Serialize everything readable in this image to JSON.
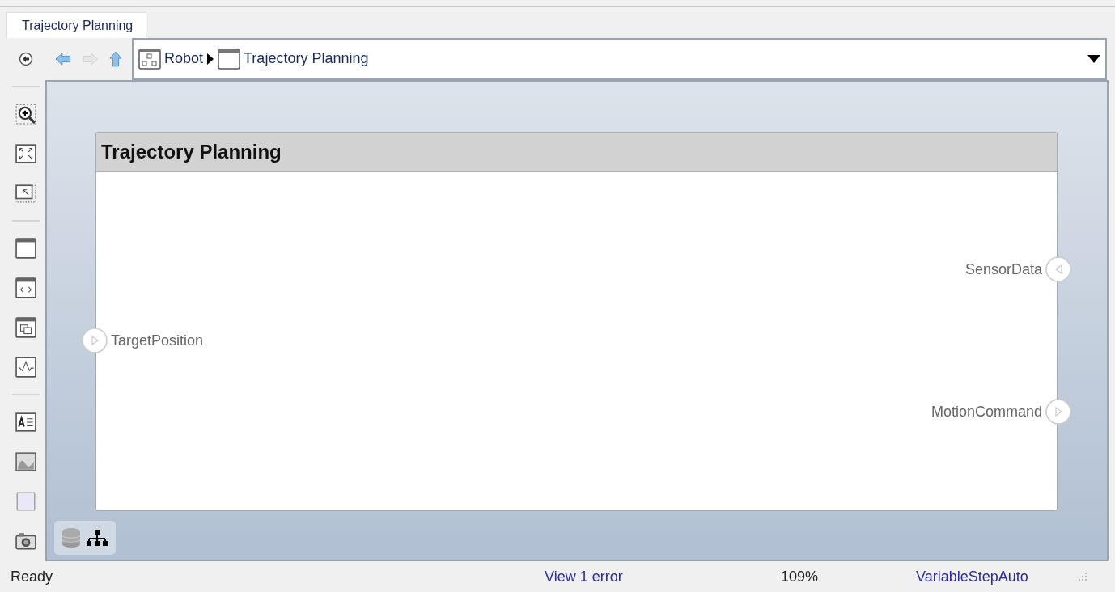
{
  "tabs": [
    {
      "label": "Trajectory Planning",
      "selected": true
    }
  ],
  "navigation": [
    {
      "kind": "back",
      "disabled": false
    },
    {
      "kind": "forward",
      "disabled": true
    },
    {
      "kind": "up",
      "disabled": false
    }
  ],
  "breadcrumb": [
    {
      "label": "Robot",
      "kind": "model"
    },
    {
      "label": "Trajectory Planning",
      "kind": "component"
    }
  ],
  "component": {
    "title": "Trajectory Planning",
    "ports": [
      {
        "name": "SensorData",
        "kind": "right-in"
      },
      {
        "name": "TargetPosition",
        "kind": "left-in"
      },
      {
        "name": "MotionCommand",
        "kind": "right-out"
      }
    ]
  },
  "status_bar": {
    "state": "Ready",
    "errors_link": "View 1 error",
    "zoom": "109%",
    "solver": "VariableStepAuto"
  }
}
